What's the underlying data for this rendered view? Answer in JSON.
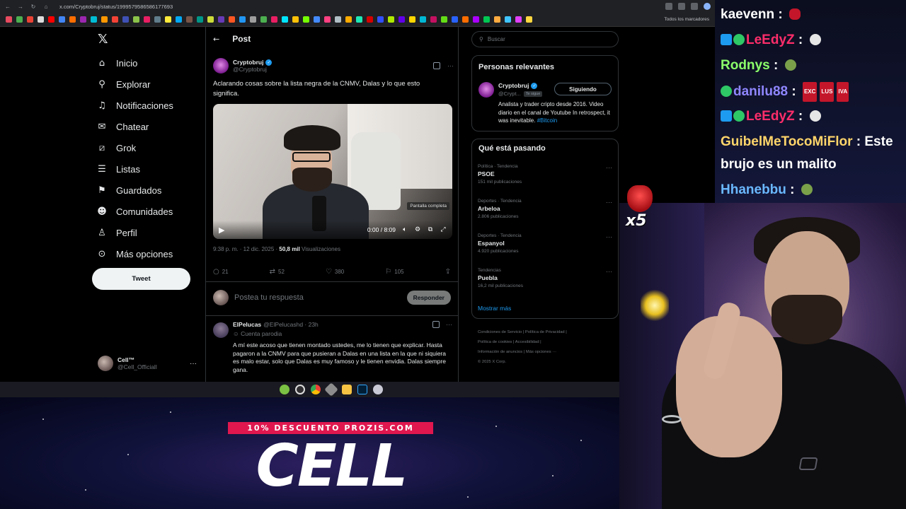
{
  "browser": {
    "url": "x.com/Cryptobruj/status/1999579586586177693",
    "bookmarks_folder": "Todos los marcadores"
  },
  "sidebar": {
    "items": [
      {
        "label": "Inicio",
        "icon": "home-icon"
      },
      {
        "label": "Explorar",
        "icon": "search-icon"
      },
      {
        "label": "Notificaciones",
        "icon": "bell-icon"
      },
      {
        "label": "Chatear",
        "icon": "mail-icon"
      },
      {
        "label": "Grok",
        "icon": "grok-icon"
      },
      {
        "label": "Listas",
        "icon": "list-icon"
      },
      {
        "label": "Guardados",
        "icon": "bookmark-icon"
      },
      {
        "label": "Comunidades",
        "icon": "community-icon"
      },
      {
        "label": "Perfil",
        "icon": "person-icon"
      },
      {
        "label": "Más opciones",
        "icon": "more-icon"
      }
    ],
    "tweet_button": "Tweet",
    "account": {
      "name": "Cell™",
      "handle": "@Cell_Officiall"
    }
  },
  "post": {
    "header_title": "Post",
    "author_name": "Cryptobruj",
    "author_handle": "@Cryptobruj",
    "text": "Aclarando cosas sobre la lista negra de la CNMV, Dalas y lo que esto significa.",
    "video": {
      "time": "0:00 / 8:09",
      "fullscreen_tooltip": "Pantalla completa"
    },
    "meta_time": "9:38 p. m. · 12 dic. 2025 ·",
    "views_count": "50,8 mil",
    "views_label": "Visualizaciones",
    "stats": {
      "replies": "21",
      "reposts": "52",
      "likes": "380",
      "bookmarks": "105"
    },
    "reply_placeholder": "Postea tu respuesta",
    "reply_button": "Responder"
  },
  "comment": {
    "name": "ElPelucas",
    "handle": "@ElPelucashd · 23h",
    "parody_label": "Cuenta parodia",
    "text": "A mí este acoso que tienen montado ustedes, me lo tienen que explicar. Hasta pagaron a la CNMV para que pusieran a Dalas en una lista en la que ni siquiera es malo estar, solo que Dalas es muy famoso y le tienen envidia. Dalas siempre gana."
  },
  "right": {
    "search_placeholder": "Buscar",
    "relevant_title": "Personas relevantes",
    "relevant_person": {
      "name": "Cryptobruj",
      "handle": "@Crypt...",
      "follows_you": "Te sigue",
      "button": "Siguiendo",
      "bio": "Analista y trader cripto desde 2016. Video diario en el canal de Youtube In retrospect, it was inevitable.",
      "bio_tag": "#Bitcoin"
    },
    "trends_title": "Qué está pasando",
    "trends": [
      {
        "category": "Política · Tendencia",
        "name": "PSOE",
        "count": "151 mil publicaciones"
      },
      {
        "category": "Deportes · Tendencia",
        "name": "Arbeloa",
        "count": "2.806 publicaciones"
      },
      {
        "category": "Deportes · Tendencia",
        "name": "Espanyol",
        "count": "4.920 publicaciones"
      },
      {
        "category": "Tendencias",
        "name": "Puebla",
        "count": "16,2 mil publicaciones"
      }
    ],
    "show_more": "Mostrar más",
    "footer_line1": "Condiciones de Servicio  |  Política de Privacidad  |",
    "footer_line2": "Política de cookies  |  Accesibilidad  |",
    "footer_line3": "Información de anuncios  |  Más opciones ···",
    "footer_line4": "© 2025 X Corp."
  },
  "overlay": {
    "promo": "10% DESCUENTO PROZIS.COM",
    "logo": "CELL",
    "gift_multiplier": "x5"
  },
  "chat": {
    "messages": [
      {
        "user": "kaevenn",
        "text": "",
        "color": "#ffffff"
      },
      {
        "user": "LeEdyZ",
        "text": "",
        "color": "#ff2d6a"
      },
      {
        "user": "Rodnys",
        "text": "",
        "color": "#8bff6a"
      },
      {
        "user": "danilu88",
        "text": "",
        "color": "#8f86ff"
      },
      {
        "user": "LeEdyZ",
        "text": "",
        "color": "#ff2d6a"
      },
      {
        "user": "GuibelMeTocoMiFlor",
        "text": "Este",
        "color": "#ffd56a"
      },
      {
        "user": "",
        "text": "brujo es un malito",
        "color": "#ffffff"
      },
      {
        "user": "Hhanebbu",
        "text": "",
        "color": "#6ab8ff"
      }
    ],
    "danilu_badges": [
      "EXC",
      "LUS",
      "IVA"
    ]
  }
}
